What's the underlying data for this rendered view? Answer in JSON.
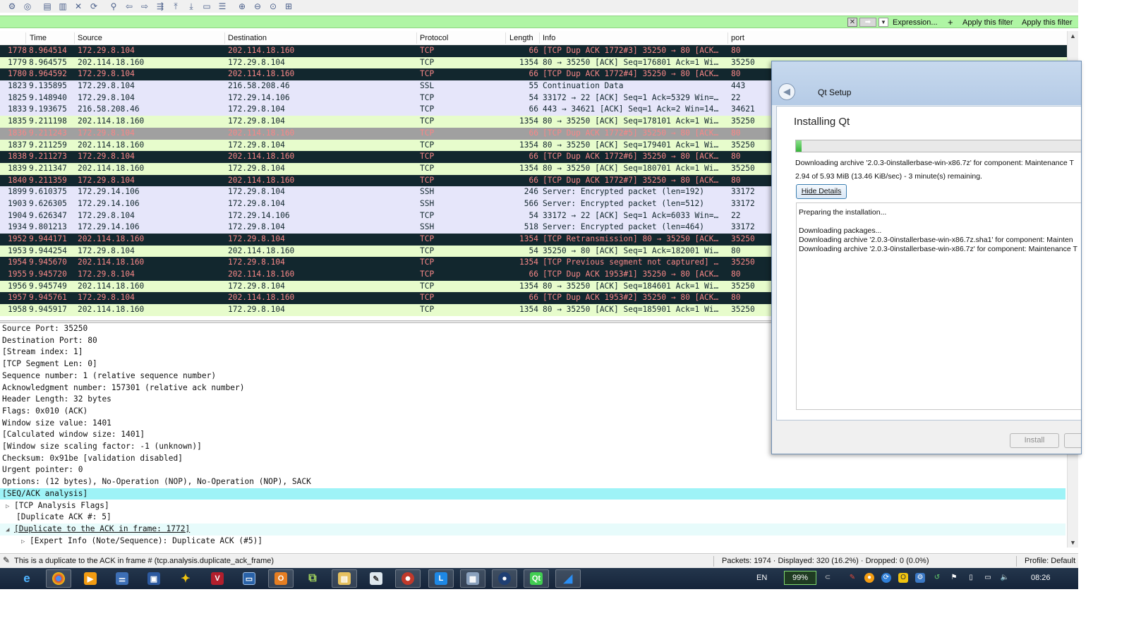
{
  "filter": {
    "value": "",
    "expression_label": "Expression...",
    "add_label": "+",
    "apply_filter_1": "Apply this filter",
    "apply_filter_2": "Apply this filter"
  },
  "packet_list": {
    "columns": [
      "Time",
      "Source",
      "Destination",
      "Protocol",
      "Length",
      "Info",
      "port"
    ],
    "rows": [
      {
        "no": "1778",
        "time": "8.964514",
        "src": "172.29.8.104",
        "dst": "202.114.18.160",
        "proto": "TCP",
        "len": "66",
        "info": "[TCP Dup ACK 1772#3] 35250 → 80 [ACK…",
        "port": "80",
        "style": "dark"
      },
      {
        "no": "1779",
        "time": "8.964575",
        "src": "202.114.18.160",
        "dst": "172.29.8.104",
        "proto": "TCP",
        "len": "1354",
        "info": "80 → 35250 [ACK] Seq=176801 Ack=1 Wi…",
        "port": "35250",
        "style": "green"
      },
      {
        "no": "1780",
        "time": "8.964592",
        "src": "172.29.8.104",
        "dst": "202.114.18.160",
        "proto": "TCP",
        "len": "66",
        "info": "[TCP Dup ACK 1772#4] 35250 → 80 [ACK…",
        "port": "80",
        "style": "dark"
      },
      {
        "no": "1823",
        "time": "9.135895",
        "src": "172.29.8.104",
        "dst": "216.58.208.46",
        "proto": "SSL",
        "len": "55",
        "info": "Continuation Data",
        "port": "443",
        "style": "lav"
      },
      {
        "no": "1825",
        "time": "9.148940",
        "src": "172.29.8.104",
        "dst": "172.29.14.106",
        "proto": "TCP",
        "len": "54",
        "info": "33172 → 22 [ACK] Seq=1 Ack=5329 Win=…",
        "port": "22",
        "style": "lav"
      },
      {
        "no": "1833",
        "time": "9.193675",
        "src": "216.58.208.46",
        "dst": "172.29.8.104",
        "proto": "TCP",
        "len": "66",
        "info": "443 → 34621 [ACK] Seq=1 Ack=2 Win=14…",
        "port": "34621",
        "style": "lav"
      },
      {
        "no": "1835",
        "time": "9.211198",
        "src": "202.114.18.160",
        "dst": "172.29.8.104",
        "proto": "TCP",
        "len": "1354",
        "info": "80 → 35250 [ACK] Seq=178101 Ack=1 Wi…",
        "port": "35250",
        "style": "green"
      },
      {
        "no": "1836",
        "time": "9.211243",
        "src": "172.29.8.104",
        "dst": "202.114.18.160",
        "proto": "TCP",
        "len": "66",
        "info": "[TCP Dup ACK 1772#5] 35250 → 80 [ACK…",
        "port": "80",
        "style": "grey"
      },
      {
        "no": "1837",
        "time": "9.211259",
        "src": "202.114.18.160",
        "dst": "172.29.8.104",
        "proto": "TCP",
        "len": "1354",
        "info": "80 → 35250 [ACK] Seq=179401 Ack=1 Wi…",
        "port": "35250",
        "style": "green"
      },
      {
        "no": "1838",
        "time": "9.211273",
        "src": "172.29.8.104",
        "dst": "202.114.18.160",
        "proto": "TCP",
        "len": "66",
        "info": "[TCP Dup ACK 1772#6] 35250 → 80 [ACK…",
        "port": "80",
        "style": "dark"
      },
      {
        "no": "1839",
        "time": "9.211347",
        "src": "202.114.18.160",
        "dst": "172.29.8.104",
        "proto": "TCP",
        "len": "1354",
        "info": "80 → 35250 [ACK] Seq=180701 Ack=1 Wi…",
        "port": "35250",
        "style": "green"
      },
      {
        "no": "1840",
        "time": "9.211359",
        "src": "172.29.8.104",
        "dst": "202.114.18.160",
        "proto": "TCP",
        "len": "66",
        "info": "[TCP Dup ACK 1772#7] 35250 → 80 [ACK…",
        "port": "80",
        "style": "dark"
      },
      {
        "no": "1899",
        "time": "9.610375",
        "src": "172.29.14.106",
        "dst": "172.29.8.104",
        "proto": "SSH",
        "len": "246",
        "info": "Server: Encrypted packet (len=192)",
        "port": "33172",
        "style": "lav"
      },
      {
        "no": "1903",
        "time": "9.626305",
        "src": "172.29.14.106",
        "dst": "172.29.8.104",
        "proto": "SSH",
        "len": "566",
        "info": "Server: Encrypted packet (len=512)",
        "port": "33172",
        "style": "lav"
      },
      {
        "no": "1904",
        "time": "9.626347",
        "src": "172.29.8.104",
        "dst": "172.29.14.106",
        "proto": "TCP",
        "len": "54",
        "info": "33172 → 22 [ACK] Seq=1 Ack=6033 Win=…",
        "port": "22",
        "style": "lav"
      },
      {
        "no": "1934",
        "time": "9.801213",
        "src": "172.29.14.106",
        "dst": "172.29.8.104",
        "proto": "SSH",
        "len": "518",
        "info": "Server: Encrypted packet (len=464)",
        "port": "33172",
        "style": "lav"
      },
      {
        "no": "1952",
        "time": "9.944171",
        "src": "202.114.18.160",
        "dst": "172.29.8.104",
        "proto": "TCP",
        "len": "1354",
        "info": "[TCP Retransmission] 80 → 35250 [ACK…",
        "port": "35250",
        "style": "dark"
      },
      {
        "no": "1953",
        "time": "9.944254",
        "src": "172.29.8.104",
        "dst": "202.114.18.160",
        "proto": "TCP",
        "len": "54",
        "info": "35250 → 80 [ACK] Seq=1 Ack=182001 Wi…",
        "port": "80",
        "style": "green"
      },
      {
        "no": "1954",
        "time": "9.945670",
        "src": "202.114.18.160",
        "dst": "172.29.8.104",
        "proto": "TCP",
        "len": "1354",
        "info": "[TCP Previous segment not captured] …",
        "port": "35250",
        "style": "dark"
      },
      {
        "no": "1955",
        "time": "9.945720",
        "src": "172.29.8.104",
        "dst": "202.114.18.160",
        "proto": "TCP",
        "len": "66",
        "info": "[TCP Dup ACK 1953#1] 35250 → 80 [ACK…",
        "port": "80",
        "style": "dark"
      },
      {
        "no": "1956",
        "time": "9.945749",
        "src": "202.114.18.160",
        "dst": "172.29.8.104",
        "proto": "TCP",
        "len": "1354",
        "info": "80 → 35250 [ACK] Seq=184601 Ack=1 Wi…",
        "port": "35250",
        "style": "green"
      },
      {
        "no": "1957",
        "time": "9.945761",
        "src": "172.29.8.104",
        "dst": "202.114.18.160",
        "proto": "TCP",
        "len": "66",
        "info": "[TCP Dup ACK 1953#2] 35250 → 80 [ACK…",
        "port": "80",
        "style": "dark"
      },
      {
        "no": "1958",
        "time": "9.945917",
        "src": "202.114.18.160",
        "dst": "172.29.8.104",
        "proto": "TCP",
        "len": "1354",
        "info": "80 → 35250 [ACK] Seq=185901 Ack=1 Wi…",
        "port": "35250",
        "style": "green"
      }
    ]
  },
  "details": {
    "lines": [
      {
        "text": "Source Port: 35250",
        "kind": "plain"
      },
      {
        "text": "Destination Port: 80",
        "kind": "plain"
      },
      {
        "text": "[Stream index: 1]",
        "kind": "plain"
      },
      {
        "text": "[TCP Segment Len: 0]",
        "kind": "plain"
      },
      {
        "text": "Sequence number: 1    (relative sequence number)",
        "kind": "plain"
      },
      {
        "text": "Acknowledgment number: 157301    (relative ack number)",
        "kind": "plain"
      },
      {
        "text": "Header Length: 32 bytes",
        "kind": "plain"
      },
      {
        "text": "Flags: 0x010 (ACK)",
        "kind": "plain"
      },
      {
        "text": "Window size value: 1401",
        "kind": "plain"
      },
      {
        "text": "[Calculated window size: 1401]",
        "kind": "plain"
      },
      {
        "text": "[Window size scaling factor: -1 (unknown)]",
        "kind": "plain"
      },
      {
        "text": "Checksum: 0x91be [validation disabled]",
        "kind": "plain"
      },
      {
        "text": "Urgent pointer: 0",
        "kind": "plain"
      },
      {
        "text": "Options: (12 bytes), No-Operation (NOP), No-Operation (NOP), SACK",
        "kind": "plain"
      },
      {
        "text": "[SEQ/ACK analysis]",
        "kind": "highlight"
      },
      {
        "text": "[TCP Analysis Flags]",
        "kind": "collapsed"
      },
      {
        "text": "[Duplicate ACK #: 5]",
        "kind": "child"
      },
      {
        "text": "[Duplicate to the ACK in frame: 1772]",
        "kind": "selected"
      },
      {
        "text": "[Expert Info (Note/Sequence): Duplicate ACK (#5)]",
        "kind": "collapsed2"
      }
    ]
  },
  "statusbar": {
    "message": "This is a duplicate to the ACK in frame # (tcp.analysis.duplicate_ack_frame)",
    "packets": "Packets: 1974 · Displayed: 320 (16.2%) · Dropped: 0 (0.0%)",
    "profile": "Profile: Default"
  },
  "taskbar": {
    "language": "EN",
    "battery": "99%",
    "clock": "08:26"
  },
  "qt_setup": {
    "window_title": "Qt Setup",
    "heading": "Installing Qt",
    "progress_fraction": 0.02,
    "status_line_1": "Downloading archive '2.0.3-0installerbase-win-x86.7z' for component: Maintenance T",
    "status_line_2": "2.94 of 5.93 MiB (13.46 KiB/sec) - 3 minute(s) remaining.",
    "hide_details_label": "Hide Details",
    "log_lines": [
      "Preparing the installation...",
      "",
      "Downloading packages...",
      "Downloading archive '2.0.3-0installerbase-win-x86.7z.sha1' for component: Mainten",
      "Downloading archive '2.0.3-0installerbase-win-x86.7z' for component: Maintenance T"
    ],
    "install_label": "Install"
  }
}
